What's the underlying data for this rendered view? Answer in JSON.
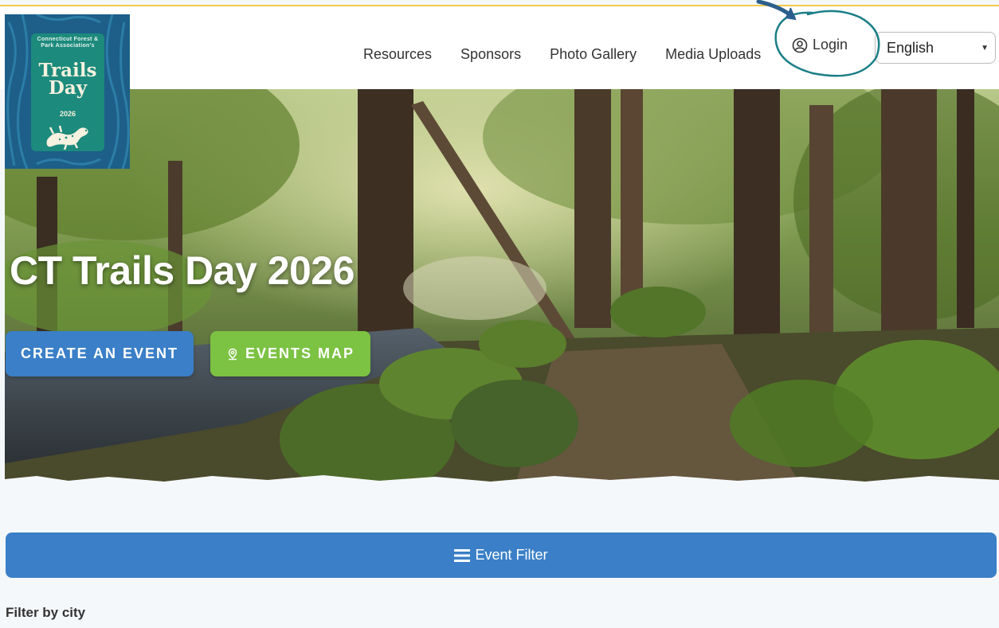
{
  "header": {
    "logo": {
      "small_text": "Connecticut Forest & Park Association's",
      "big_text": "Trails Day",
      "year": "2026",
      "icon": "salamander-icon"
    },
    "nav": [
      {
        "label": "Resources"
      },
      {
        "label": "Sponsors"
      },
      {
        "label": "Photo Gallery"
      },
      {
        "label": "Media Uploads"
      }
    ],
    "login": {
      "label": "Login",
      "icon": "user-circle-icon"
    },
    "language": {
      "selected": "English"
    }
  },
  "hero": {
    "title": "CT Trails Day 2026",
    "buttons": {
      "create_event": "CREATE AN EVENT",
      "events_map": "EVENTS MAP"
    }
  },
  "filter": {
    "bar_label": "Event Filter",
    "bar_icon": "hamburger-menu-icon",
    "city_label": "Filter by city"
  },
  "colors": {
    "primary_blue": "#3a7fc7",
    "accent_green": "#7cc243",
    "annotation_teal": "#1b7f86",
    "top_line_yellow": "#f2c94c"
  }
}
